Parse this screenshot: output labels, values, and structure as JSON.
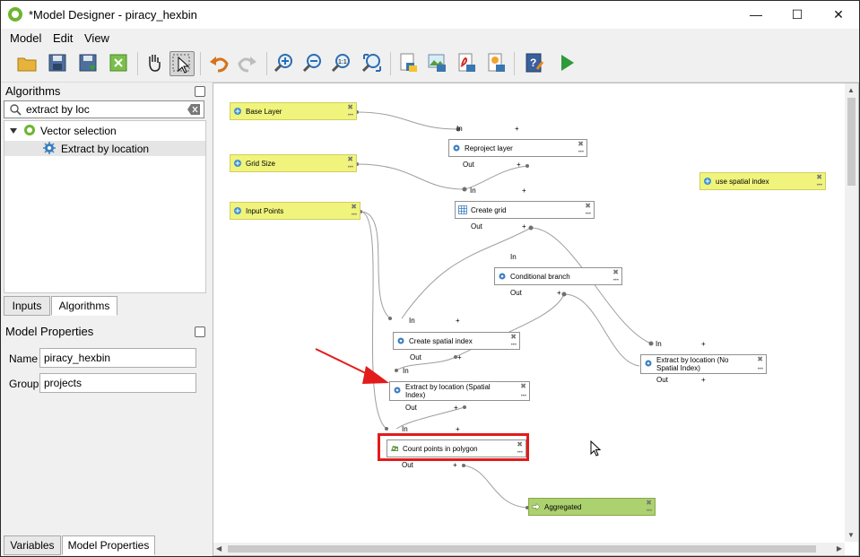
{
  "window": {
    "title": "*Model Designer - piracy_hexbin"
  },
  "menu": {
    "model": "Model",
    "edit": "Edit",
    "view": "View"
  },
  "algorithms_panel": {
    "title": "Algorithms",
    "search_value": "extract by loc",
    "tree": {
      "group": "Vector selection",
      "item": "Extract by location"
    },
    "tabs": {
      "inputs": "Inputs",
      "algorithms": "Algorithms"
    }
  },
  "model_properties": {
    "title": "Model Properties",
    "name_label": "Name",
    "name_value": "piracy_hexbin",
    "group_label": "Group",
    "group_value": "projects"
  },
  "bottom_tabs": {
    "variables": "Variables",
    "model_properties": "Model Properties"
  },
  "canvas": {
    "port_in": "In",
    "port_out": "Out",
    "plus": "+",
    "nodes": {
      "base_layer": "Base Layer",
      "grid_size": "Grid Size",
      "input_points": "Input Points",
      "use_spatial_index": "use spatial index",
      "reproject": "Reproject layer",
      "create_grid": "Create grid",
      "conditional": "Conditional branch",
      "create_index": "Create spatial index",
      "extract_spatial_1": "Extract by location (Spatial",
      "extract_spatial_2": "Index)",
      "extract_nospatial_1": "Extract by location (No",
      "extract_nospatial_2": "Spatial Index)",
      "count_points": "Count points in polygon",
      "aggregated": "Aggregated"
    }
  },
  "colors": {
    "input_node": "#f0f47c",
    "output_node": "#acd16f",
    "highlight": "#e31b1b",
    "run_green": "#2e9a3a"
  }
}
